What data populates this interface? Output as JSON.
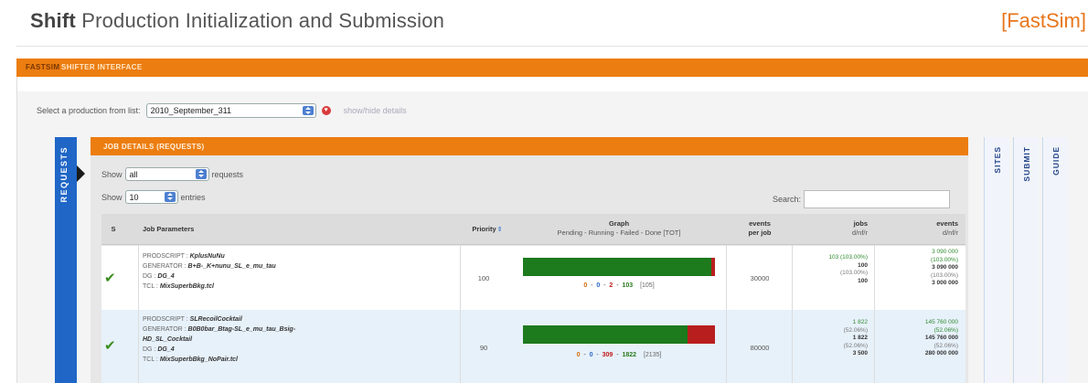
{
  "header": {
    "title_strong": "Shift",
    "title_rest": " Production Initialization and Submission",
    "fastsim_link": "[FastSim]"
  },
  "topbar": {
    "brand": "FASTSIM",
    "label": "SHIFTER INTERFACE"
  },
  "production": {
    "select_label": "Select a production from list:",
    "selected": "2010_September_311",
    "show_hide": "show/hide details"
  },
  "tabs": {
    "requests": "REQUESTS",
    "sites": "SITES",
    "submit": "SUBMIT",
    "guide": "GUIDE"
  },
  "job_details": {
    "title": "JOB DETAILS (REQUESTS)",
    "show_label": "Show",
    "filter_value": "all",
    "requests_label": "requests",
    "entries_value": "10",
    "entries_label": "entries",
    "search_label": "Search:",
    "search_value": ""
  },
  "table": {
    "columns": {
      "status": "S",
      "params": "Job Parameters",
      "priority": "Priority",
      "graph_title": "Graph",
      "graph_sub": "Pending - Running - Failed - Done [TOT]",
      "events_per_job_1": "events",
      "events_per_job_2": "per job",
      "jobs_1": "jobs",
      "jobs_2": "d/nf/r",
      "events_1": "events",
      "events_2": "d/nf/r"
    },
    "rows": [
      {
        "prodscript_label": "PRODSCRIPT :",
        "prodscript": "KplusNuNu",
        "generator_label": "GENERATOR :",
        "generator": "B+B-_K+nunu_SL_e_mu_tau",
        "dg_label": "DG :",
        "dg": "DG_4",
        "tcl_label": "TCL :",
        "tcl": "MixSuperbBkg.tcl",
        "priority": "100",
        "pending": "0",
        "running": "0",
        "failed": "2",
        "done": "103",
        "total": "[105]",
        "done_fraction": 0.98,
        "failed_fraction": 0.019,
        "events_per_job": "30000",
        "jobs": [
          "103 (103.00%)",
          "100",
          "(103.00%)",
          "100"
        ],
        "events": [
          "3 090 000",
          "(103.00%)",
          "3 090 000",
          "(103.00%)",
          "3 000 000"
        ]
      },
      {
        "prodscript_label": "PRODSCRIPT :",
        "prodscript": "SLRecoilCocktail",
        "generator_label": "GENERATOR :",
        "generator": "B0B0bar_Btag-SL_e_mu_tau_Bsig-",
        "generator_2": "HD_SL_Cocktail",
        "dg_label": "DG :",
        "dg": "DG_4",
        "tcl_label": "TCL :",
        "tcl": "MixSuperbBkg_NoPair.tcl",
        "priority": "90",
        "pending": "0",
        "running": "0",
        "failed": "309",
        "done": "1822",
        "total": "[2135]",
        "done_fraction": 0.85,
        "failed_fraction": 0.145,
        "events_per_job": "80000",
        "jobs": [
          "1 822",
          "(52.06%)",
          "1 822",
          "(52.06%)",
          "3 500"
        ],
        "events": [
          "145 760 000",
          "(52.06%)",
          "145 760 000",
          "(52.06%)",
          "280 000 000"
        ]
      }
    ]
  }
}
